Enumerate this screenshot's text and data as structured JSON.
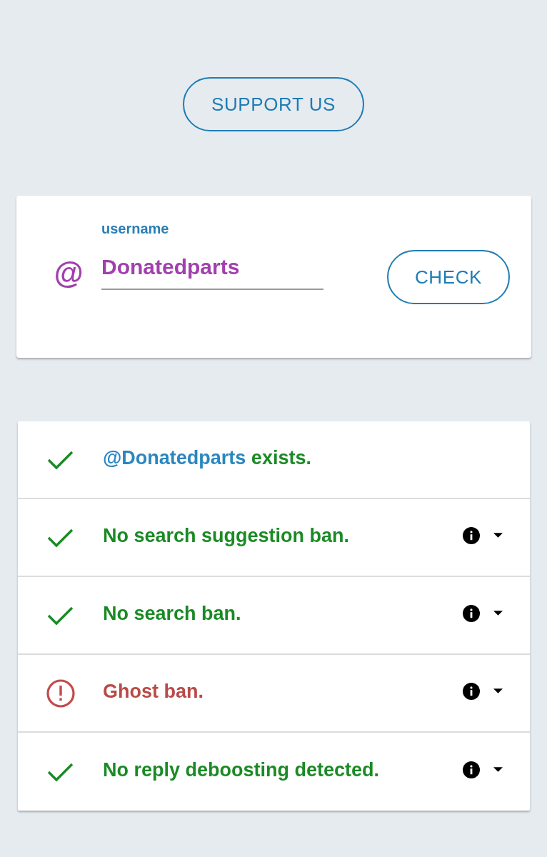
{
  "support_button": {
    "label": "SUPPORT US"
  },
  "search_card": {
    "prefix": "@",
    "field_label": "username",
    "value": "Donatedparts",
    "button": "CHECK"
  },
  "results": [
    {
      "passed": true,
      "handle": "@Donatedparts",
      "text": "exists.",
      "details": false
    },
    {
      "passed": true,
      "text": "No search suggestion ban.",
      "details": true
    },
    {
      "passed": true,
      "text": "No search ban.",
      "details": true
    },
    {
      "passed": false,
      "text": "Ghost ban.",
      "details": true
    },
    {
      "passed": true,
      "text": "No reply deboosting detected.",
      "details": true
    }
  ]
}
